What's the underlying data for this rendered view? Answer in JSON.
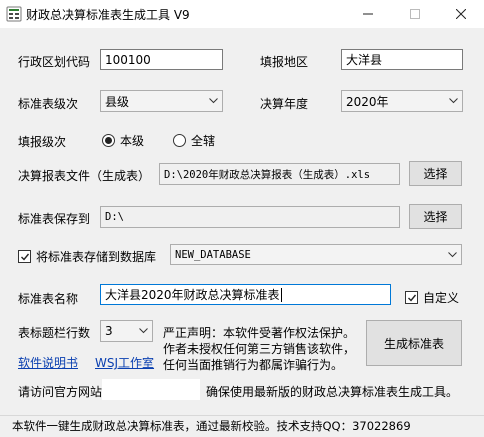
{
  "window": {
    "title": "财政总决算标准表生成工具 V9",
    "controls": [
      "minimize-icon",
      "maximize-icon",
      "close-icon"
    ]
  },
  "form": {
    "region_code": {
      "label": "行政区划代码",
      "value": "100100"
    },
    "region_name": {
      "label": "填报地区",
      "value": "大洋县"
    },
    "std_level": {
      "label": "标准表级次",
      "value": "县级"
    },
    "year": {
      "label": "决算年度",
      "value": "2020年"
    },
    "fill_level": {
      "label": "填报级次",
      "options": [
        {
          "label": "本级",
          "selected": true
        },
        {
          "label": "全辖",
          "selected": false
        }
      ]
    },
    "report_file": {
      "label": "决算报表文件（生成表）",
      "value": "D:\\2020年财政总决算报表（生成表）.xls",
      "button": "选择"
    },
    "save_to": {
      "label": "标准表保存到",
      "value": "D:\\",
      "button": "选择"
    },
    "save_db": {
      "label": "将标准表存储到数据库",
      "checked": true,
      "value": "NEW_DATABASE"
    },
    "table_name": {
      "label": "标准表名称",
      "value": "大洋县2020年财政总决算标准表",
      "custom_label": "自定义",
      "custom_checked": true
    },
    "header_rows": {
      "label": "表标题栏行数",
      "value": "3"
    }
  },
  "notice": {
    "line1": "严正声明：本软件受著作权法保护。",
    "line2": "作者未授权任何第三方销售该软件，",
    "line3": "任何当面推销行为都属诈骗行为。"
  },
  "actions": {
    "generate": "生成标准表",
    "manual_link": "软件说明书",
    "studio_link": "WSJ工作室"
  },
  "visit": {
    "prefix": "请访问官方网站",
    "suffix": "确保使用最新版的财政总决算标准表生成工具。"
  },
  "status": {
    "text": "本软件一键生成财政总决算标准表，通过最新校验。技术支持QQ：37022869"
  },
  "colors": {
    "window_bg": "#f0f0f0",
    "link": "#0a3fb0",
    "icon_accent": "#2f7d32"
  }
}
